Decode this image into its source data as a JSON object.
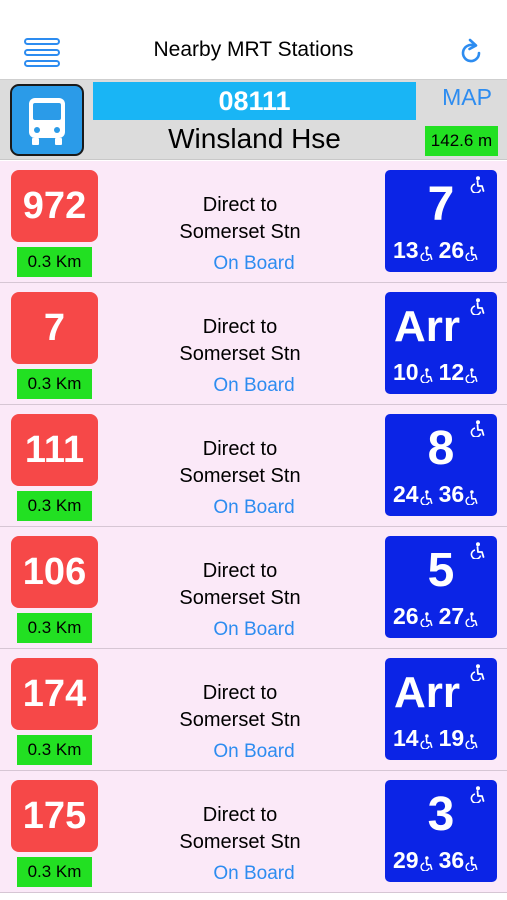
{
  "header": {
    "title": "Nearby MRT Stations"
  },
  "stop": {
    "code": "08111",
    "name": "Winsland Hse",
    "map_label": "MAP",
    "distance": "142.6 m"
  },
  "accent_colors": {
    "service": "#f64848",
    "arrival": "#0b24e6",
    "distance": "#22e022",
    "link": "#2d8cf0"
  },
  "buses": [
    {
      "service": "972",
      "km": "0.3 Km",
      "dest_line1": "Direct to",
      "dest_line2": "Somerset Stn",
      "on_board": "On Board",
      "next": "7",
      "next2": "13",
      "next3": "26"
    },
    {
      "service": "7",
      "km": "0.3 Km",
      "dest_line1": "Direct to",
      "dest_line2": "Somerset Stn",
      "on_board": "On Board",
      "next": "Arr",
      "next2": "10",
      "next3": "12"
    },
    {
      "service": "111",
      "km": "0.3 Km",
      "dest_line1": "Direct to",
      "dest_line2": "Somerset Stn",
      "on_board": "On Board",
      "next": "8",
      "next2": "24",
      "next3": "36"
    },
    {
      "service": "106",
      "km": "0.3 Km",
      "dest_line1": "Direct to",
      "dest_line2": "Somerset Stn",
      "on_board": "On Board",
      "next": "5",
      "next2": "26",
      "next3": "27"
    },
    {
      "service": "174",
      "km": "0.3 Km",
      "dest_line1": "Direct to",
      "dest_line2": "Somerset Stn",
      "on_board": "On Board",
      "next": "Arr",
      "next2": "14",
      "next3": "19"
    },
    {
      "service": "175",
      "km": "0.3 Km",
      "dest_line1": "Direct to",
      "dest_line2": "Somerset Stn",
      "on_board": "On Board",
      "next": "3",
      "next2": "29",
      "next3": "36"
    }
  ]
}
